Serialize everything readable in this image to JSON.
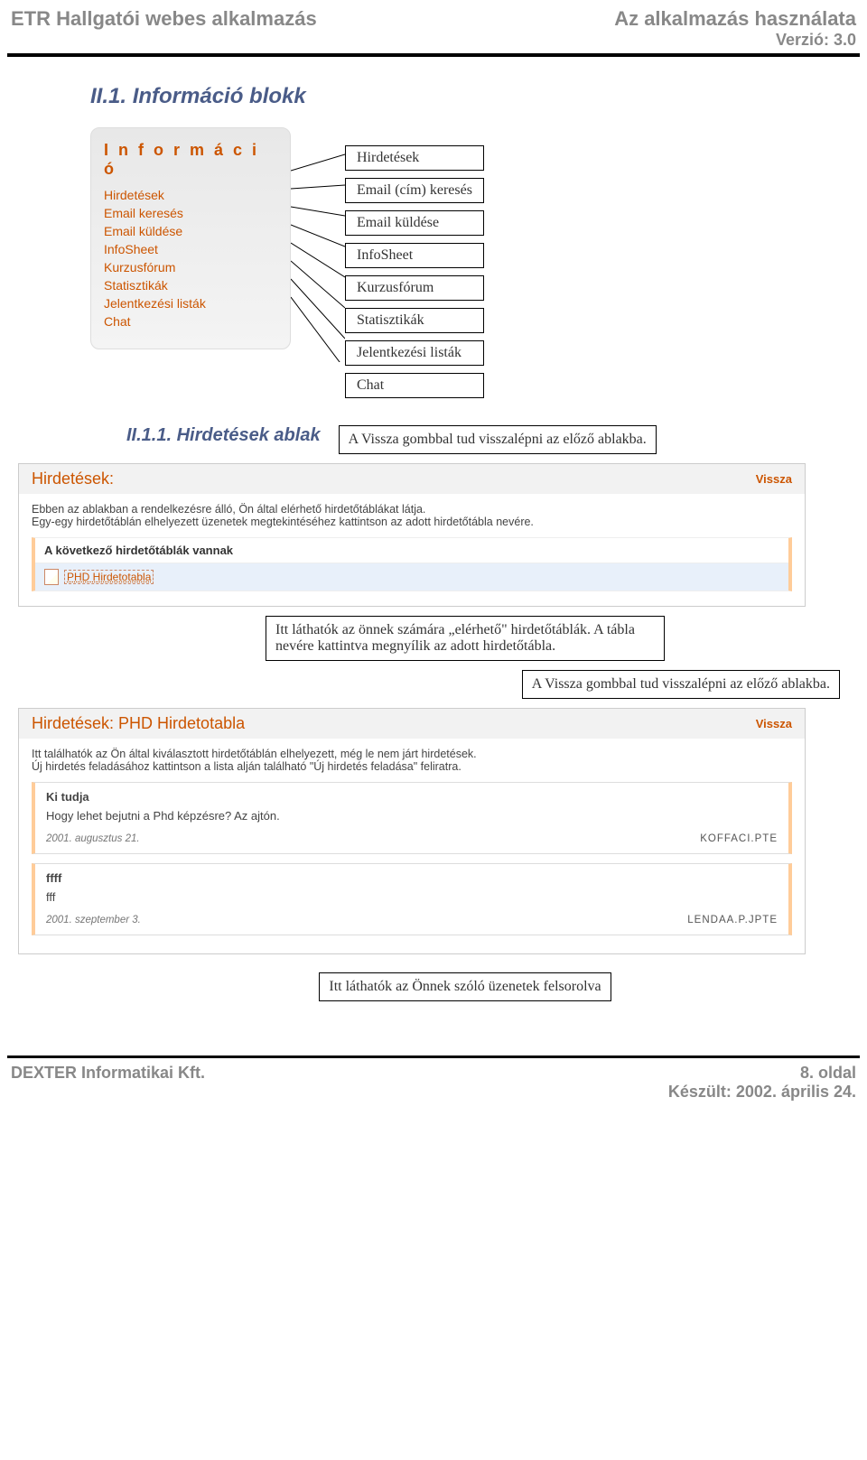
{
  "header": {
    "left": "ETR Hallgatói webes alkalmazás",
    "right_top": "Az alkalmazás használata",
    "right_version": "Verzió: 3.0"
  },
  "section": {
    "title": "II.1. Információ blokk",
    "sub1_title": "II.1.1. Hirdetések ablak"
  },
  "menu": {
    "header": "I n f o r m á c i ó",
    "items": [
      "Hirdetések",
      "Email keresés",
      "Email küldése",
      "InfoSheet",
      "Kurzusfórum",
      "Statisztikák",
      "Jelentkezési listák",
      "Chat"
    ]
  },
  "labels": {
    "b0": "Hirdetések",
    "b1": "Email (cím) keresés",
    "b2": "Email küldése",
    "b3": "InfoSheet",
    "b4": "Kurzusfórum",
    "b5": "Statisztikák",
    "b6": "Jelentkezési listák",
    "b7": "Chat"
  },
  "annot": {
    "vissza_note": "A Vissza gombbal tud visszalépni az előző ablakba.",
    "elerheto_note": "Itt láthatók az önnek számára „elérhető\" hirdetőtáblák. A tábla nevére kattintva megnyílik az adott hirdetőtábla.",
    "uzenetek_note": "Itt láthatók az Önnek szóló üzenetek felsorolva"
  },
  "panel1": {
    "title": "Hirdetések:",
    "vissza": "Vissza",
    "desc1": "Ebben az ablakban a rendelkezésre álló, Ön által elérhető hirdetőtáblákat látja.",
    "desc2": "Egy-egy hirdetőtáblán elhelyezett üzenetek megtekintéséhez kattintson az adott hirdetőtábla nevére.",
    "sub_hdr": "A következő hirdetőtáblák vannak",
    "board_link": "PHD Hirdetotabla"
  },
  "panel2": {
    "title": "Hirdetések: PHD Hirdetotabla",
    "vissza": "Vissza",
    "desc1": "Itt találhatók az Ön által kiválasztott hirdetőtáblán elhelyezett, még le nem járt hirdetések.",
    "desc2": "Új hirdetés feladásához kattintson a lista alján található \"Új hirdetés feladása\" feliratra.",
    "messages": [
      {
        "title": "Ki tudja",
        "text": "Hogy lehet bejutni a Phd képzésre? Az ajtón.",
        "date": "2001. augusztus 21.",
        "author": "KOFFACI.PTE"
      },
      {
        "title": "ffff",
        "text": "fff",
        "date": "2001. szeptember 3.",
        "author": "LENDAA.P.JPTE"
      }
    ]
  },
  "footer": {
    "left": "DEXTER Informatikai Kft.",
    "page": "8. oldal",
    "date": "Készült: 2002. április 24."
  }
}
